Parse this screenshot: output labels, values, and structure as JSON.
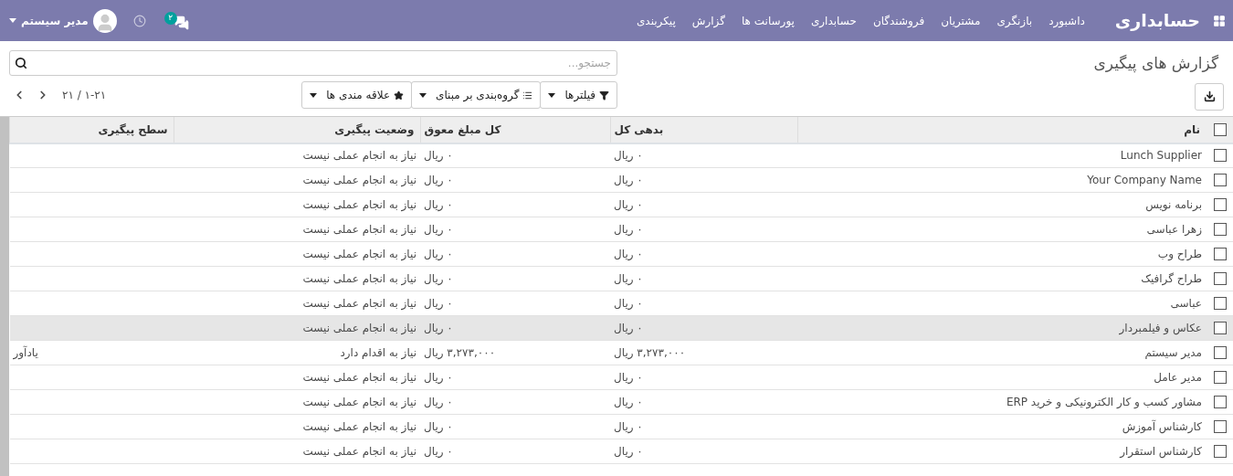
{
  "navbar": {
    "brand": "حسابداری",
    "menus": [
      "داشبورد",
      "بازنگری",
      "مشتریان",
      "فروشندگان",
      "حسابداری",
      "پورسانت ها",
      "گزارش",
      "پیکربندی"
    ],
    "messages_badge": "۲",
    "user": "مدیر سیستم"
  },
  "title": "گزارش های پیگیری",
  "search": {
    "placeholder": "جستجو..."
  },
  "search_buttons": [
    {
      "kind": "filter",
      "label": "فیلترها"
    },
    {
      "kind": "group",
      "label": "گروه‌بندی بر مبنای"
    },
    {
      "kind": "favorite",
      "label": "علاقه مندی ها"
    }
  ],
  "pager": "۱-۲۱ / ۲۱",
  "table": {
    "select_all": {
      "checked": false
    },
    "columns": [
      "نام",
      "بدهی کل",
      "کل مبلغ معوق",
      "وضعیت پیگیری",
      "سطح پیگیری"
    ],
    "rows": [
      {
        "checked": false,
        "highlighted": false,
        "name": "Lunch Supplier",
        "debt": "۰ ریال",
        "overdue": "۰ ریال",
        "status": "نیاز به انجام عملی نیست"
      },
      {
        "checked": false,
        "highlighted": false,
        "name": "Your Company Name",
        "debt": "۰ ریال",
        "overdue": "۰ ریال",
        "status": "نیاز به انجام عملی نیست"
      },
      {
        "checked": false,
        "highlighted": false,
        "name": "برنامه نویس",
        "debt": "۰ ریال",
        "overdue": "۰ ریال",
        "status": "نیاز به انجام عملی نیست"
      },
      {
        "checked": false,
        "highlighted": false,
        "name": "زهرا عباسی",
        "debt": "۰ ریال",
        "overdue": "۰ ریال",
        "status": "نیاز به انجام عملی نیست"
      },
      {
        "checked": false,
        "highlighted": false,
        "name": "طراح وب",
        "debt": "۰ ریال",
        "overdue": "۰ ریال",
        "status": "نیاز به انجام عملی نیست"
      },
      {
        "checked": false,
        "highlighted": false,
        "name": "طراح گرافیک",
        "debt": "۰ ریال",
        "overdue": "۰ ریال",
        "status": "نیاز به انجام عملی نیست"
      },
      {
        "checked": false,
        "highlighted": false,
        "name": "عباسی",
        "debt": "۰ ریال",
        "overdue": "۰ ریال",
        "status": "نیاز به انجام عملی نیست"
      },
      {
        "checked": false,
        "highlighted": true,
        "name": "عکاس و فیلمبردار",
        "debt": "۰ ریال",
        "overdue": "۰ ریال",
        "status": "نیاز به انجام عملی نیست"
      },
      {
        "checked": false,
        "highlighted": false,
        "name": "مدیر سیستم",
        "debt": "۳,۲۷۳,۰۰۰ ریال",
        "overdue": "۳,۲۷۳,۰۰۰ ریال",
        "status": "نیاز به اقدام دارد",
        "level": "یادآور"
      },
      {
        "checked": false,
        "highlighted": false,
        "name": "مدیر عامل",
        "debt": "۰ ریال",
        "overdue": "۰ ریال",
        "status": "نیاز به انجام عملی نیست"
      },
      {
        "checked": false,
        "highlighted": false,
        "name": "مشاور کسب و کار الکترونیکی و خرید ERP",
        "debt": "۰ ریال",
        "overdue": "۰ ریال",
        "status": "نیاز به انجام عملی نیست"
      },
      {
        "checked": false,
        "highlighted": false,
        "name": "کارشناس آموزش",
        "debt": "۰ ریال",
        "overdue": "۰ ریال",
        "status": "نیاز به انجام عملی نیست"
      },
      {
        "checked": false,
        "highlighted": false,
        "name": "کارشناس استقرار",
        "debt": "۰ ریال",
        "overdue": "۰ ریال",
        "status": "نیاز به انجام عملی نیست"
      }
    ]
  }
}
